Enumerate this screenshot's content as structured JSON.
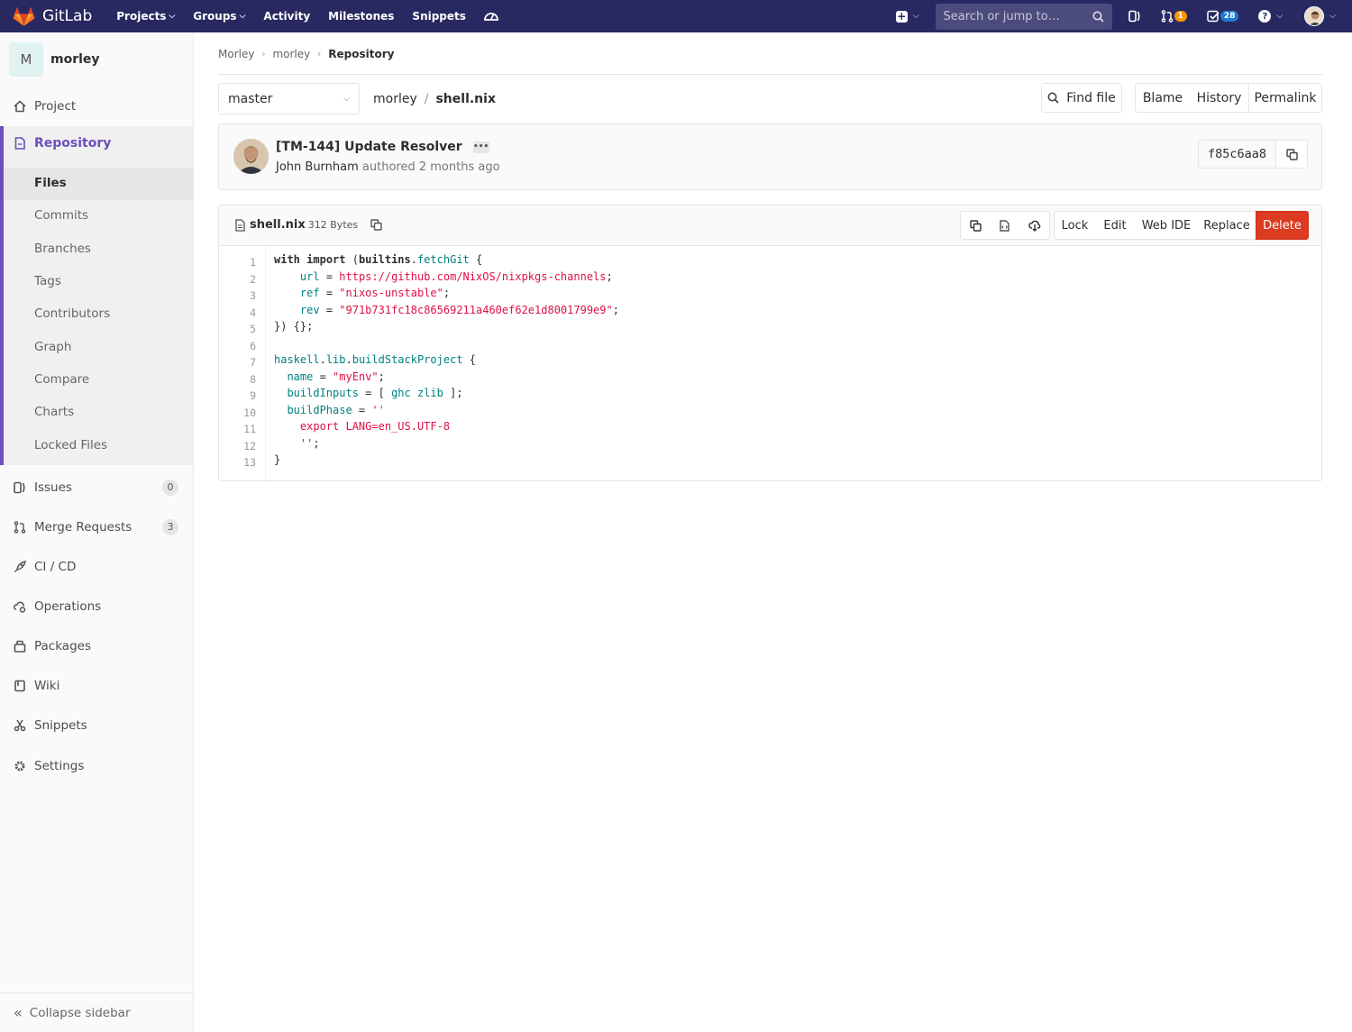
{
  "navbar": {
    "brand": "GitLab",
    "links": [
      {
        "label": "Projects",
        "dropdown": true
      },
      {
        "label": "Groups",
        "dropdown": true
      },
      {
        "label": "Activity",
        "dropdown": false
      },
      {
        "label": "Milestones",
        "dropdown": false
      },
      {
        "label": "Snippets",
        "dropdown": false
      }
    ],
    "search_placeholder": "Search or jump to…",
    "merge_requests_count": "1",
    "todos_count": "28"
  },
  "sidebar": {
    "project_initial": "M",
    "project_name": "morley",
    "items": [
      {
        "label": "Project",
        "icon": "home-icon"
      },
      {
        "label": "Repository",
        "icon": "repository-icon"
      },
      {
        "label": "Issues",
        "icon": "issues-icon",
        "count": "0"
      },
      {
        "label": "Merge Requests",
        "icon": "merge-request-icon",
        "count": "3"
      },
      {
        "label": "CI / CD",
        "icon": "rocket-icon"
      },
      {
        "label": "Operations",
        "icon": "cloud-gear-icon"
      },
      {
        "label": "Packages",
        "icon": "package-icon"
      },
      {
        "label": "Wiki",
        "icon": "book-icon"
      },
      {
        "label": "Snippets",
        "icon": "scissors-icon"
      },
      {
        "label": "Settings",
        "icon": "gear-icon"
      }
    ],
    "repository_sub": [
      "Files",
      "Commits",
      "Branches",
      "Tags",
      "Contributors",
      "Graph",
      "Compare",
      "Charts",
      "Locked Files"
    ],
    "collapse_label": "Collapse sidebar"
  },
  "breadcrumb": [
    "Morley",
    "morley",
    "Repository"
  ],
  "toolbar": {
    "branch": "master",
    "path_root": "morley",
    "path_file": "shell.nix",
    "find_file": "Find file",
    "blame": "Blame",
    "history": "History",
    "permalink": "Permalink"
  },
  "commit": {
    "title": "[TM-144] Update Resolver",
    "author": "John Burnham",
    "meta": "authored 2 months ago",
    "sha": "f85c6aa8"
  },
  "file": {
    "name": "shell.nix",
    "size": "312 Bytes",
    "buttons": {
      "lock": "Lock",
      "edit": "Edit",
      "web_ide": "Web IDE",
      "replace": "Replace",
      "delete": "Delete"
    },
    "line_numbers": [
      "1",
      "2",
      "3",
      "4",
      "5",
      "6",
      "7",
      "8",
      "9",
      "10",
      "11",
      "12",
      "13"
    ],
    "lines": [
      "with import (builtins.fetchGit {",
      "    url = https://github.com/NixOS/nixpkgs-channels;",
      "    ref = \"nixos-unstable\";",
      "    rev = \"971b731fc18c86569211a460ef62e1d8001799e9\";",
      "}) {};",
      "",
      "haskell.lib.buildStackProject {",
      "  name = \"myEnv\";",
      "  buildInputs = [ ghc zlib ];",
      "  buildPhase = ''",
      "    export LANG=en_US.UTF-8",
      "    '';",
      "}"
    ]
  },
  "colors": {
    "navbar": "#292961",
    "accent": "#6b4fbb",
    "delete": "#db3b21",
    "string": "#dd1144",
    "attr": "#008080"
  }
}
